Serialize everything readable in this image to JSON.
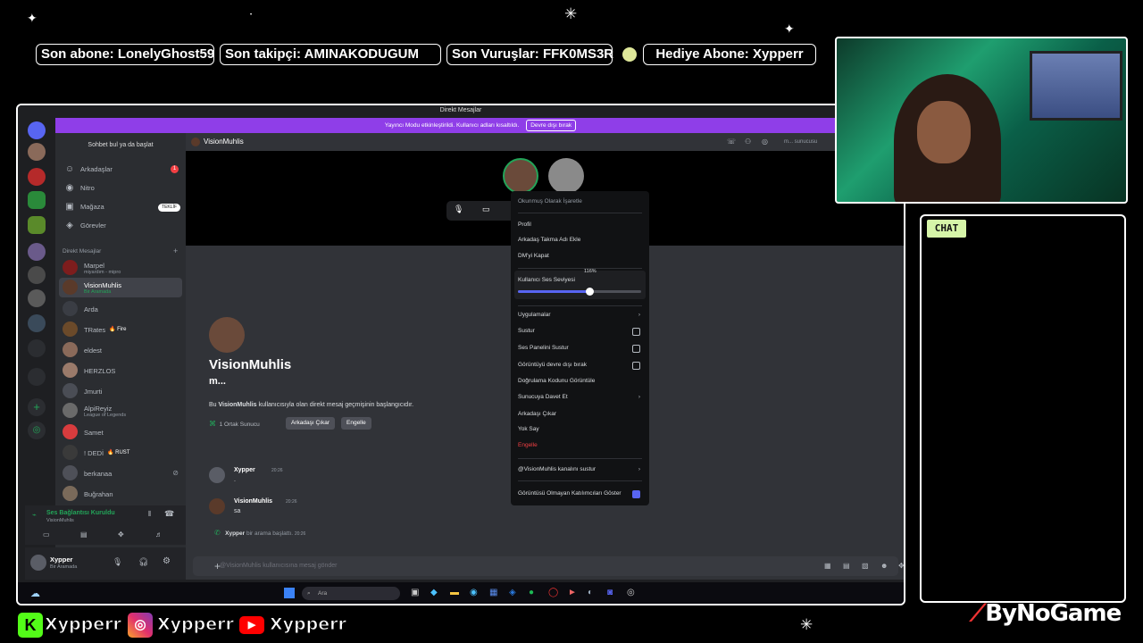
{
  "overlay": {
    "ticker": [
      "Son abone: LonelyGhost59",
      "Son takipçi: AMINAKODUGUM",
      "Son Vuruşlar: FFK0MS3R",
      "Hediye Abone: Xypperr"
    ],
    "chat_label": "CHAT",
    "brand": "ByNoGame",
    "socials": [
      {
        "platform": "kick",
        "handle": "Xypperr"
      },
      {
        "platform": "instagram",
        "handle": "Xypperr"
      },
      {
        "platform": "youtube",
        "handle": "Xypperr"
      }
    ]
  },
  "discord": {
    "window_title": "Direkt Mesajlar",
    "banner": {
      "text": "Yayıncı Modu etkinleştirildi. Kullanıcı adları kısaltıldı.",
      "button": "Devre dışı bırak"
    },
    "search": "Sohbet bul ya da başlat",
    "nav": [
      {
        "label": "Arkadaşlar",
        "icon": "friends-icon",
        "badge": "1"
      },
      {
        "label": "Nitro",
        "icon": "nitro-icon"
      },
      {
        "label": "Mağaza",
        "icon": "shop-icon",
        "tag": "TEKLİF"
      },
      {
        "label": "Görevler",
        "icon": "quests-icon"
      }
    ],
    "dm_header": "Direkt Mesajlar",
    "dm_add": "+",
    "dms": [
      {
        "name": "Marpel",
        "sub": "miyardım - mipro",
        "color": "#7d1d1d"
      },
      {
        "name": "VisionMuhlis",
        "sub": "Bir Aramada",
        "color": "#5a3a2a",
        "active": true
      },
      {
        "name": "Arda",
        "color": "#3a3d44"
      },
      {
        "name": "TRates",
        "badge": "Fire",
        "color": "#6b4a2a"
      },
      {
        "name": "eldest",
        "color": "#8a6a5a"
      },
      {
        "name": "HERZLOS",
        "color": "#9a7a6a"
      },
      {
        "name": "Jmurti",
        "color": "#4a4d55"
      },
      {
        "name": "AlpiReyiz",
        "sub": "League of Legends",
        "color": "#6a6a6a"
      },
      {
        "name": "Samet",
        "color": "#d83c3e"
      },
      {
        "name": "! DEDİ",
        "badge": "RUST",
        "color": "#3a3a3a"
      },
      {
        "name": "berkanaa",
        "color": "#4e5058"
      },
      {
        "name": "Buğrahan",
        "color": "#7a6a5a"
      }
    ],
    "voice": {
      "status": "Ses Bağlantısı Kuruldu",
      "channel": "VisionMuhlis"
    },
    "user": {
      "name": "Xypper",
      "status": "Bir Aramada"
    },
    "chat": {
      "header": "VisionMuhlis",
      "header_right": "m... sunucusu",
      "profile_name": "VisionMuhlis",
      "profile_handle": "m...",
      "intro_pre": "Bu ",
      "intro_name": "VisionMuhlis",
      "intro_post": " kullanıcısıyla olan direkt mesaj geçmişinin başlangıcıdır.",
      "mutual": "1 Ortak Sunucu",
      "btn_remove": "Arkadaşı Çıkar",
      "btn_block": "Engelle",
      "messages": [
        {
          "author": "Xypper",
          "time": "20:26",
          "text": "."
        },
        {
          "author": "VisionMuhlis",
          "time": "20:26",
          "text": "sa"
        }
      ],
      "call_author": "Xypper",
      "call_text": " bir arama başlattı. ",
      "call_time": "20:26",
      "input_placeholder": "@VisionMuhlis kullanıcısına mesaj gönder"
    },
    "taskbar": {
      "search": "Ara"
    },
    "menu": {
      "mark_read": "Okunmuş Olarak İşaretle",
      "items_a": [
        "Profil",
        "Arkadaş Takma Adı Ekle",
        "DM'yi Kapat"
      ],
      "volume_label": "Kullanıcı Ses Seviyesi",
      "volume_value": "116%",
      "volume_fraction": 0.58,
      "apps": "Uygulamalar",
      "mute": "Sustur",
      "mute_sound": "Ses Panelini Sustur",
      "disable_video": "Görüntüyü devre dışı bırak",
      "verify": "Doğrulama Kodunu Görüntüle",
      "invite": "Sunucuya Davet Et",
      "remove_friend": "Arkadaşı Çıkar",
      "ignore": "Yok Say",
      "block": "Engelle",
      "mute_channel": "@VisionMuhlis kanalını sustur",
      "show_nonvideo": "Görüntüsü Olmayan Katılımcıları Göster"
    }
  }
}
